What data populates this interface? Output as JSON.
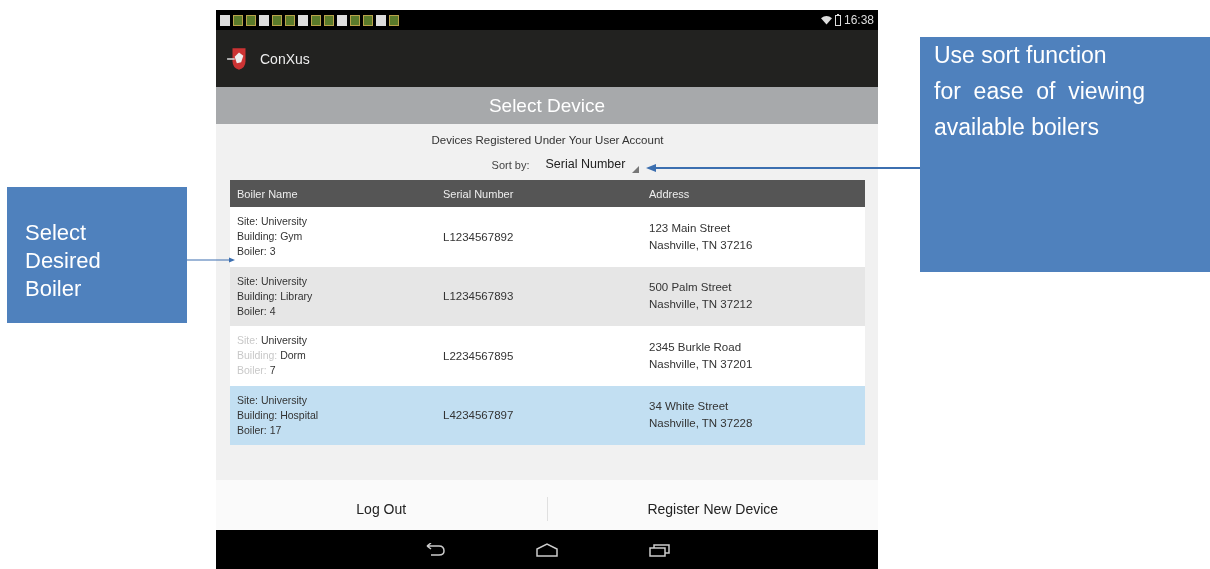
{
  "status_bar": {
    "time": "16:38"
  },
  "app_bar": {
    "title": "ConXus"
  },
  "screen_title": "Select Device",
  "subtitle": "Devices Registered Under Your User Account",
  "sort": {
    "label": "Sort by:",
    "value": "Serial Number"
  },
  "table": {
    "columns": [
      "Boiler Name",
      "Serial Number",
      "Address"
    ],
    "rows": [
      {
        "name_lines": [
          {
            "label": "Site:",
            "value": "University"
          },
          {
            "label": "Building:",
            "value": "Gym"
          },
          {
            "label": "Boiler:",
            "value": "3"
          }
        ],
        "serial": "L1234567892",
        "address": [
          "123 Main Street",
          "Nashville, TN 37216"
        ],
        "selected": false,
        "faded_labels": false
      },
      {
        "name_lines": [
          {
            "label": "Site:",
            "value": "University"
          },
          {
            "label": "Building:",
            "value": "Library"
          },
          {
            "label": "Boiler:",
            "value": "4"
          }
        ],
        "serial": "L1234567893",
        "address": [
          "500 Palm Street",
          "Nashville, TN 37212"
        ],
        "selected": false,
        "faded_labels": false
      },
      {
        "name_lines": [
          {
            "label": "Site:",
            "value": "University"
          },
          {
            "label": "Building:",
            "value": "Dorm"
          },
          {
            "label": "Boiler:",
            "value": "7"
          }
        ],
        "serial": "L2234567895",
        "address": [
          "2345 Burkle Road",
          "Nashville, TN 37201"
        ],
        "selected": false,
        "faded_labels": true
      },
      {
        "name_lines": [
          {
            "label": "Site:",
            "value": "University"
          },
          {
            "label": "Building:",
            "value": "Hospital"
          },
          {
            "label": "Boiler:",
            "value": "17"
          }
        ],
        "serial": "L4234567897",
        "address": [
          "34 White Street",
          "Nashville, TN 37228"
        ],
        "selected": true,
        "faded_labels": false
      }
    ]
  },
  "buttons": [
    "Log Out",
    "Register New Device"
  ],
  "callouts": [
    {
      "kind": "left",
      "lines": [
        "Select",
        "Desired",
        "Boiler"
      ]
    },
    {
      "kind": "right",
      "lines": [
        "Use sort function",
        "for  ease  of  viewing",
        "available boilers"
      ]
    }
  ]
}
